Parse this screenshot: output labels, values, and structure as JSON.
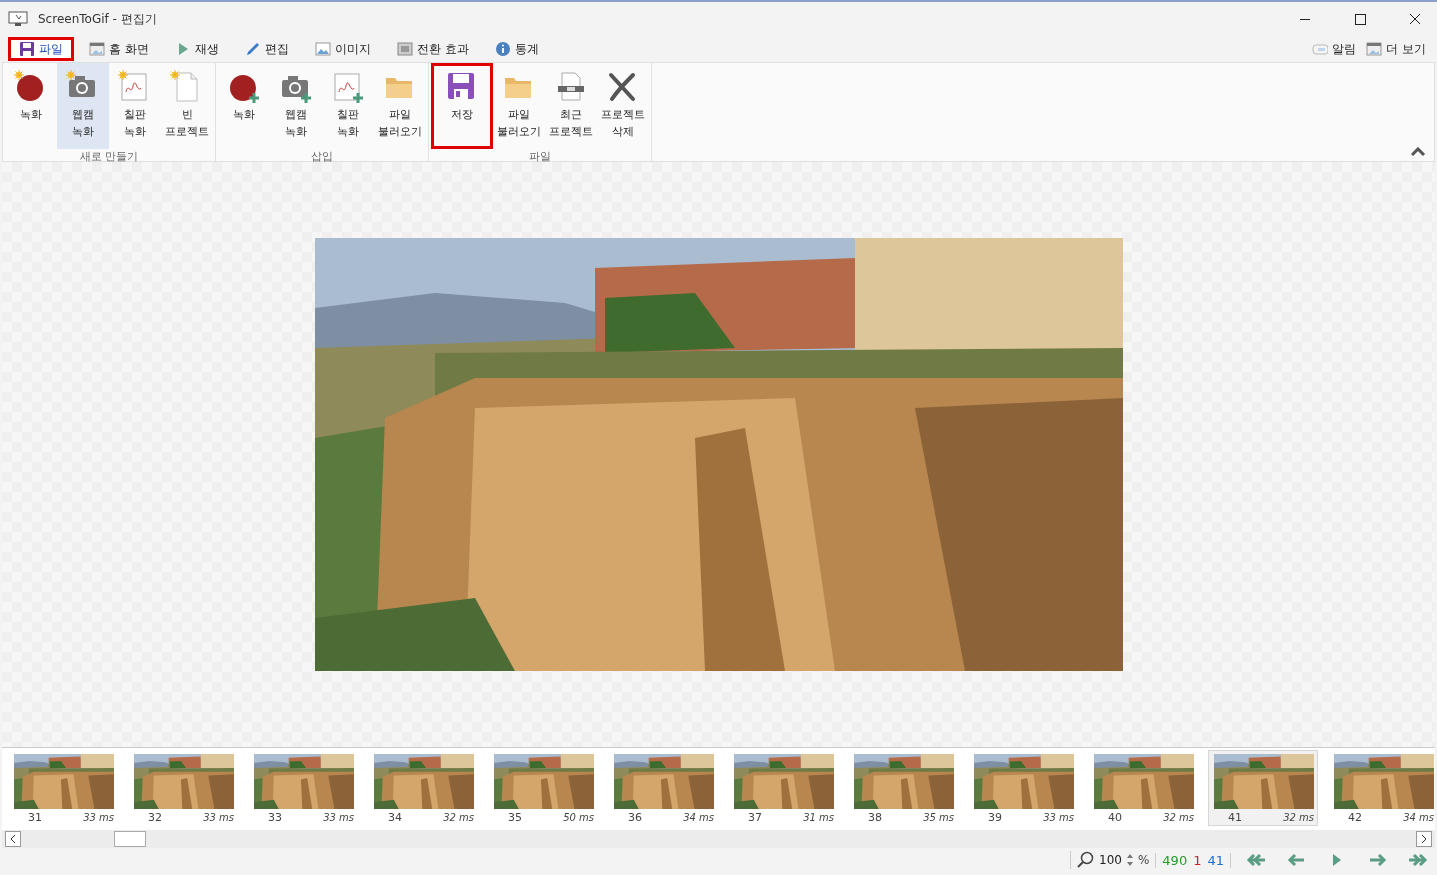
{
  "window": {
    "title": "ScreenToGif - 편집기"
  },
  "tabs": [
    {
      "label": "파일",
      "selected": true,
      "highlighted": true
    },
    {
      "label": "홈 화면",
      "selected": false,
      "highlighted": false
    },
    {
      "label": "재생",
      "selected": false,
      "highlighted": false
    },
    {
      "label": "편집",
      "selected": false,
      "highlighted": false
    },
    {
      "label": "이미지",
      "selected": false,
      "highlighted": false
    },
    {
      "label": "전환 효과",
      "selected": false,
      "highlighted": false
    },
    {
      "label": "통계",
      "selected": false,
      "highlighted": false
    }
  ],
  "top_right": [
    {
      "label": "알림"
    },
    {
      "label": "더 보기"
    }
  ],
  "ribbon": [
    {
      "title": "새로 만들기",
      "buttons": [
        {
          "label": "녹화",
          "kind": "record",
          "hovered": false,
          "highlighted": false
        },
        {
          "label": "웹캠\n녹화",
          "kind": "webcam",
          "hovered": true,
          "highlighted": false
        },
        {
          "label": "칠판\n녹화",
          "kind": "board",
          "hovered": false,
          "highlighted": false
        },
        {
          "label": "빈\n프로젝트",
          "kind": "blank",
          "hovered": false,
          "highlighted": false
        }
      ]
    },
    {
      "title": "삽입",
      "buttons": [
        {
          "label": "녹화",
          "kind": "record",
          "hovered": false,
          "highlighted": false
        },
        {
          "label": "웹캠\n녹화",
          "kind": "webcam",
          "hovered": false,
          "highlighted": false
        },
        {
          "label": "칠판\n녹화",
          "kind": "board",
          "hovered": false,
          "highlighted": false
        },
        {
          "label": "파일\n불러오기",
          "kind": "open",
          "hovered": false,
          "highlighted": false
        }
      ]
    },
    {
      "title": "파일",
      "buttons": [
        {
          "label": "저장",
          "kind": "save",
          "hovered": false,
          "highlighted": true
        },
        {
          "label": "파일\n불러오기",
          "kind": "open",
          "hovered": false,
          "highlighted": false
        },
        {
          "label": "최근\n프로젝트",
          "kind": "recent",
          "hovered": false,
          "highlighted": false
        },
        {
          "label": "프로젝트\n삭제",
          "kind": "delete",
          "hovered": false,
          "highlighted": false
        }
      ]
    }
  ],
  "frames": [
    {
      "number": "31",
      "delay": "33 ms",
      "selected": false
    },
    {
      "number": "32",
      "delay": "33 ms",
      "selected": false
    },
    {
      "number": "33",
      "delay": "33 ms",
      "selected": false
    },
    {
      "number": "34",
      "delay": "32 ms",
      "selected": false
    },
    {
      "number": "35",
      "delay": "50 ms",
      "selected": false
    },
    {
      "number": "36",
      "delay": "34 ms",
      "selected": false
    },
    {
      "number": "37",
      "delay": "31 ms",
      "selected": false
    },
    {
      "number": "38",
      "delay": "35 ms",
      "selected": false
    },
    {
      "number": "39",
      "delay": "33 ms",
      "selected": false
    },
    {
      "number": "40",
      "delay": "32 ms",
      "selected": false
    },
    {
      "number": "41",
      "delay": "32 ms",
      "selected": true
    },
    {
      "number": "42",
      "delay": "34 ms",
      "selected": false
    }
  ],
  "status_bar": {
    "zoom": "100",
    "zoom_unit": "%",
    "counts": [
      {
        "text": "490",
        "color": "#21a121"
      },
      {
        "text": "1",
        "color": "#d62020"
      },
      {
        "text": "41",
        "color": "#1f6fd0"
      }
    ]
  }
}
